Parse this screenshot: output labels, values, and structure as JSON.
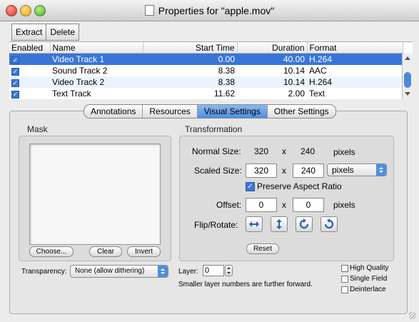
{
  "window": {
    "title": "Properties for \"apple.mov\""
  },
  "toolbar": {
    "extract": "Extract",
    "delete": "Delete"
  },
  "tracks": {
    "columns": [
      "Enabled",
      "Name",
      "Start Time",
      "Duration",
      "Format"
    ],
    "rows": [
      {
        "enabled": true,
        "name": "Video Track 1",
        "start": "0.00",
        "duration": "40.00",
        "format": "H.264"
      },
      {
        "enabled": true,
        "name": "Sound Track 2",
        "start": "8.38",
        "duration": "10.14",
        "format": "AAC"
      },
      {
        "enabled": true,
        "name": "Video Track 2",
        "start": "8.38",
        "duration": "10.14",
        "format": "H.264"
      },
      {
        "enabled": true,
        "name": "Text Track",
        "start": "11.62",
        "duration": "2.00",
        "format": "Text"
      }
    ]
  },
  "tabs": [
    "Annotations",
    "Resources",
    "Visual Settings",
    "Other Settings"
  ],
  "mask": {
    "label": "Mask",
    "choose": "Choose...",
    "clear": "Clear",
    "invert": "Invert"
  },
  "transformation": {
    "label": "Transformation",
    "normal_size_label": "Normal Size:",
    "normal_w": "320",
    "normal_h": "240",
    "x": "x",
    "pixels": "pixels",
    "scaled_size_label": "Scaled Size:",
    "scaled_w": "320",
    "scaled_h": "240",
    "scaled_unit": "pixels",
    "preserve": "Preserve Aspect Ratio",
    "offset_label": "Offset:",
    "offset_x": "0",
    "offset_y": "0",
    "flip_label": "Flip/Rotate:",
    "reset": "Reset"
  },
  "transparency": {
    "label": "Transparency:",
    "value": "None (allow dithering)"
  },
  "layer": {
    "label": "Layer:",
    "value": "0",
    "hint": "Smaller layer numbers are further forward."
  },
  "options": {
    "high_quality": "High Quality",
    "single_field": "Single Field",
    "deinterlace": "Deinterlace"
  },
  "colors": {
    "selection": "#3875d7",
    "accent": "#4d8fe0"
  }
}
